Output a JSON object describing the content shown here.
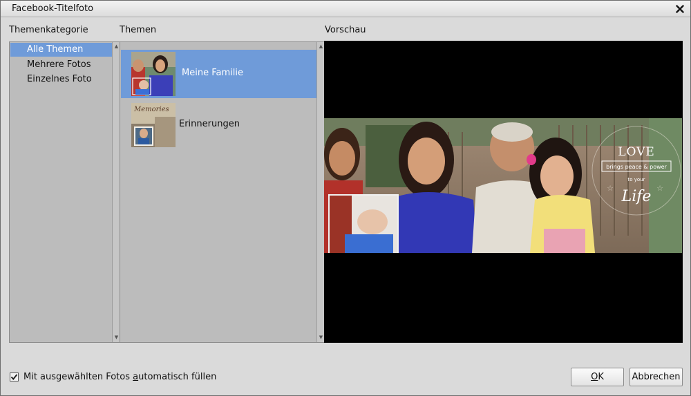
{
  "window": {
    "title": "Facebook-Titelfoto",
    "close_icon": "close-icon"
  },
  "sections": {
    "category_label": "Themenkategorie",
    "themes_label": "Themen",
    "preview_label": "Vorschau"
  },
  "categories": [
    {
      "label": "Alle Themen",
      "selected": true
    },
    {
      "label": "Mehrere Fotos",
      "selected": false
    },
    {
      "label": "Einzelnes Foto",
      "selected": false
    }
  ],
  "themes": [
    {
      "label": "Meine Familie",
      "selected": true,
      "thumb": "family-thumbnail"
    },
    {
      "label": "Erinnerungen",
      "selected": false,
      "thumb": "memories-thumbnail",
      "thumb_text": "Memories"
    }
  ],
  "preview": {
    "overlay_title": "LOVE",
    "overlay_line1": "brings peace & power",
    "overlay_line2": "to your",
    "overlay_script": "Life"
  },
  "footer": {
    "autofill_label_pre": "Mit ausgewählten Fotos ",
    "autofill_label_acc": "a",
    "autofill_label_post": "utomatisch füllen",
    "autofill_checked": true,
    "ok_acc": "O",
    "ok_rest": "K",
    "cancel_label": "Abbrechen"
  },
  "colors": {
    "selection": "#6f9bd9",
    "panel": "#bcbcbc",
    "preview_bg": "#000000"
  }
}
